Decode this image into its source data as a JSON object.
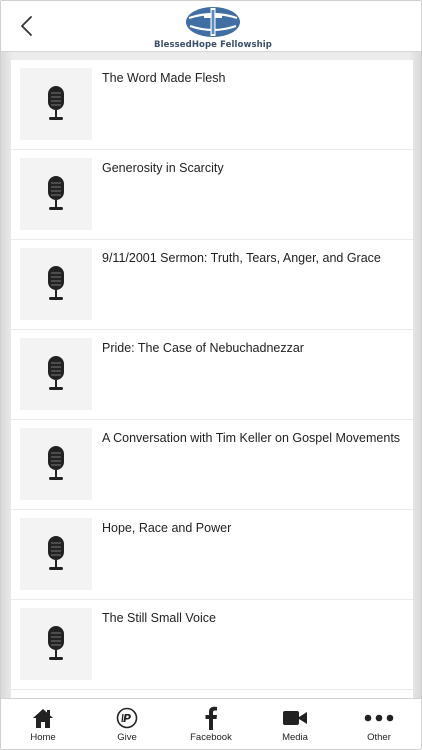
{
  "header": {
    "back_icon": "chevron-left-icon",
    "logo_text": "BlessedHope Fellowship",
    "logo_color": "#3f6fa3"
  },
  "sermons": [
    {
      "title": "The Word Made Flesh",
      "icon": "microphone-icon"
    },
    {
      "title": "Generosity in Scarcity",
      "icon": "microphone-icon"
    },
    {
      "title": "9/11/2001 Sermon: Truth, Tears, Anger, and Grace",
      "icon": "microphone-icon"
    },
    {
      "title": "Pride: The Case of Nebuchadnezzar",
      "icon": "microphone-icon"
    },
    {
      "title": "A Conversation with Tim Keller on Gospel Movements",
      "icon": "microphone-icon"
    },
    {
      "title": "Hope, Race and Power",
      "icon": "microphone-icon"
    },
    {
      "title": "The Still Small Voice",
      "icon": "microphone-icon"
    },
    {
      "title": "",
      "icon": "microphone-icon"
    }
  ],
  "tabbar": {
    "tabs": [
      {
        "label": "Home",
        "icon": "home-icon"
      },
      {
        "label": "Give",
        "icon": "give-icon"
      },
      {
        "label": "Facebook",
        "icon": "facebook-icon"
      },
      {
        "label": "Media",
        "icon": "video-camera-icon"
      },
      {
        "label": "Other",
        "icon": "more-icon"
      }
    ]
  },
  "colors": {
    "text": "#222222",
    "background": "#ececec",
    "icon": "#222222"
  }
}
